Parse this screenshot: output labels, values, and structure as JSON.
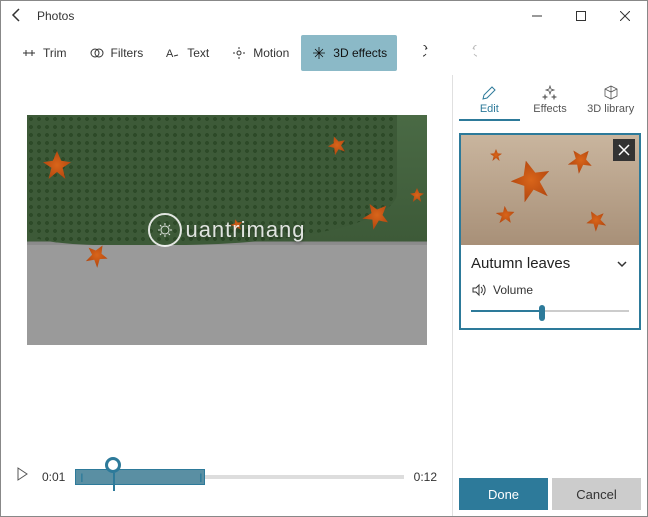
{
  "app_title": "Photos",
  "toolbar": {
    "trim": "Trim",
    "filters": "Filters",
    "text": "Text",
    "motion": "Motion",
    "effects3d": "3D effects"
  },
  "timeline": {
    "current": "0:01",
    "total": "0:12"
  },
  "side": {
    "tabs": {
      "edit": "Edit",
      "effects": "Effects",
      "library": "3D library"
    },
    "effect": {
      "name": "Autumn leaves",
      "volume_label": "Volume",
      "volume_pct": 45
    },
    "buttons": {
      "done": "Done",
      "cancel": "Cancel"
    }
  },
  "watermark": "uantrimang"
}
